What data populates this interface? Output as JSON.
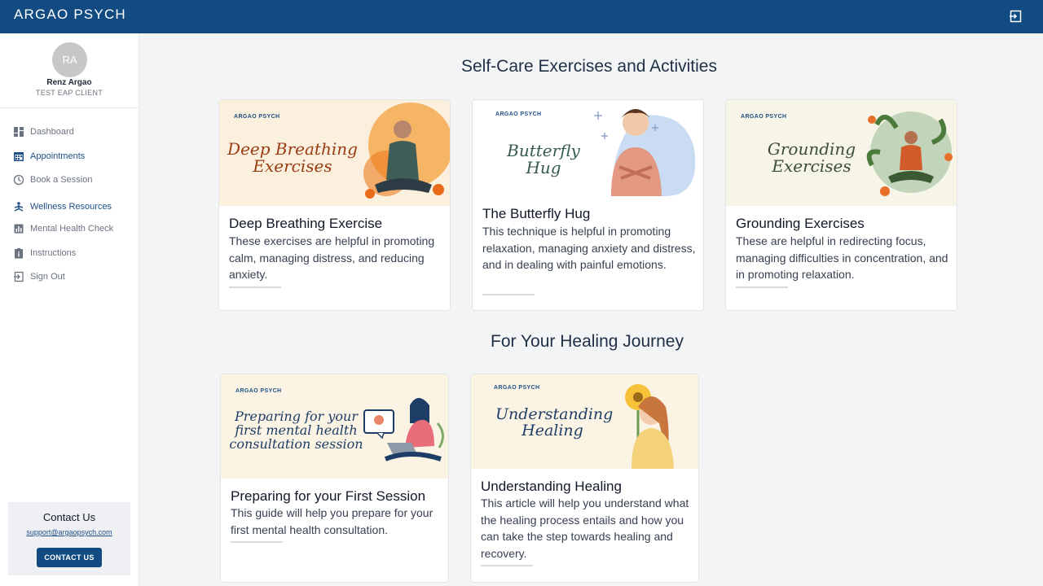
{
  "header": {
    "brand": "ARGAO PSYCH",
    "exit_icon": "logout-icon"
  },
  "sidebar": {
    "avatar_initials": "RA",
    "user_name": "Renz Argao",
    "user_role": "TEST EAP CLIENT",
    "items": [
      {
        "label": "Dashboard",
        "icon": "dashboard-icon"
      },
      {
        "label": "Appointments",
        "icon": "calendar-icon"
      },
      {
        "label": "Book a Session",
        "icon": "clock-icon"
      },
      {
        "label": "Wellness Resources",
        "icon": "meditation-icon"
      },
      {
        "label": "Mental Health Check",
        "icon": "chart-icon"
      },
      {
        "label": "Instructions",
        "icon": "clipboard-icon"
      },
      {
        "label": "Sign Out",
        "icon": "logout-icon"
      }
    ],
    "contact": {
      "title": "Contact Us",
      "email": "support@argaopsych.com",
      "button": "CONTACT US"
    }
  },
  "sections": [
    {
      "title": "Self-Care Exercises and Activities"
    },
    {
      "title": "For Your Healing Journey"
    }
  ],
  "cards": [
    {
      "title": "Deep Breathing Exercise",
      "desc": "These exercises are helpful in promoting calm, managing distress, and reducing anxiety.",
      "img_brand": "ARGAO PSYCH",
      "img_text": "Deep Breathing Exercises"
    },
    {
      "title": "The Butterfly Hug",
      "desc": "This technique is helpful in promoting relaxation, managing anxiety and distress, and in dealing with painful emotions.",
      "img_brand": "ARGAO PSYCH",
      "img_text": "Butterfly Hug"
    },
    {
      "title": "Grounding Exercises",
      "desc": "These are helpful in redirecting focus, managing difficulties in concentration, and in promoting relaxation.",
      "img_brand": "ARGAO PSYCH",
      "img_text": "Grounding Exercises"
    },
    {
      "title": "Preparing for your First Session",
      "desc": "This guide will help you prepare for your first mental health consultation.",
      "img_brand": "ARGAO PSYCH",
      "img_text": "Preparing for your first mental health consultation session"
    },
    {
      "title": "Understanding Healing",
      "desc": "This article will help you understand what the healing process entails and how you can take the step towards healing and recovery.",
      "img_brand": "ARGAO PSYCH",
      "img_text": "Understanding Healing"
    }
  ]
}
